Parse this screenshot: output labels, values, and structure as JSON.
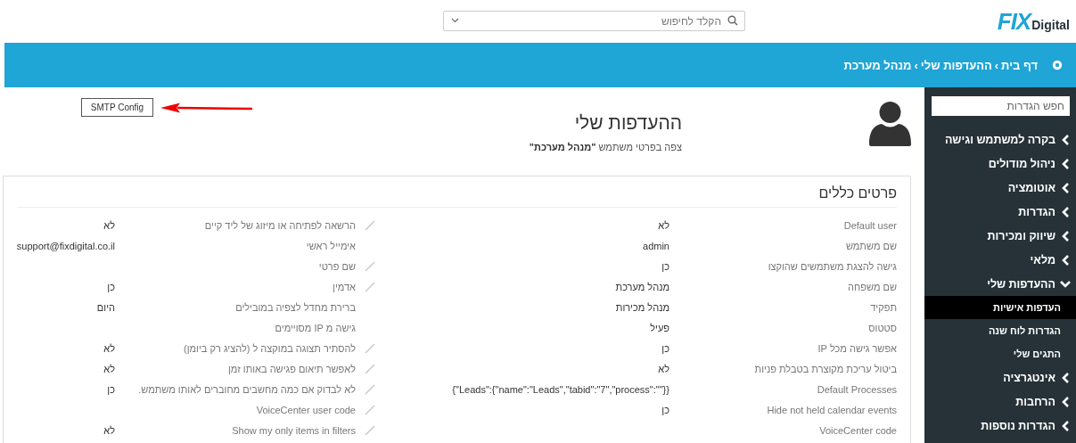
{
  "logo": {
    "mark": "FIX",
    "text": "Digital"
  },
  "search": {
    "placeholder": "הקלד לחיפוש"
  },
  "breadcrumb": {
    "separator": "›",
    "items": [
      "דף בית",
      "ההעדפות שלי",
      "מנהל מערכת"
    ]
  },
  "sidebar": {
    "search": {
      "placeholder": "חפש הגדרות"
    },
    "items": [
      {
        "label": "בקרה למשתמש וגישה",
        "expanded": false
      },
      {
        "label": "ניהול מודולים",
        "expanded": false
      },
      {
        "label": "אוטומציה",
        "expanded": false
      },
      {
        "label": "הגדרות",
        "expanded": false
      },
      {
        "label": "שיווק ומכירות",
        "expanded": false
      },
      {
        "label": "מלאי",
        "expanded": false
      },
      {
        "label": "ההעדפות שלי",
        "expanded": true,
        "children": [
          {
            "label": "העדפות אישיות",
            "selected": true
          },
          {
            "label": "הגדרות לוח שנה",
            "selected": false
          },
          {
            "label": "התגים שלי",
            "selected": false
          }
        ]
      },
      {
        "label": "אינטגרציה",
        "expanded": false
      },
      {
        "label": "הרחבות",
        "expanded": false
      },
      {
        "label": "הגדרות נוספות",
        "expanded": false
      }
    ]
  },
  "profile": {
    "title": "ההעדפות שלי",
    "subtitle": "צפה בפרטי משתמש  **\"מנהל מערכת\"**"
  },
  "smtp_button": "SMTP Config",
  "card": {
    "title": "פרטים כללים",
    "rows": [
      {
        "label": "Default user",
        "value": "לא",
        "label_2": "הרשאה לפתיחה או מיזוג של ליד קיים",
        "value_2": "לא",
        "editable_2": true
      },
      {
        "label": "שם משתמש",
        "value": "admin",
        "label_2": "אימייל ראשי",
        "value_2": "support@fixdigital.co.il",
        "editable_2": false
      },
      {
        "label": "גישה להצגת משתמשים שהוקצו",
        "value": "כן",
        "label_2": "שם פרטי",
        "editable_2": true
      },
      {
        "label": "שם משפחה",
        "value": "מנהל מערכת",
        "label_2": "אדמין",
        "value_2": "כן",
        "editable_2": true
      },
      {
        "label": "תפקיד",
        "value": "מנהל מכירות",
        "label_2": "ברירת מחדל לצפיה במובילים",
        "value_2": "היום",
        "editable_2": false
      },
      {
        "label": "סטטוס",
        "value": "פעיל",
        "label_2": "גישה מ IP מסויימים",
        "editable_2": false
      },
      {
        "label": "אפשר גישה מכל IP",
        "value": "כן",
        "label_2": "להסתיר תצוגה במוקצה ל (להציג רק ביומן)",
        "value_2": "לא",
        "editable_2": true
      },
      {
        "label": "ביטול עריכת מקוצרת בטבלת פניות",
        "value": "לא",
        "label_2": "לאפשר תיאום פגישה באותו זמן",
        "value_2": "לא",
        "editable_2": true
      },
      {
        "label": "Default Processes",
        "value": "{Leads\":{\"name\":\"Leads\",\"tabid\":\"7\",\"process\":\"\"}\"}",
        "label_2": "לא לבדוק אם כמה מחשבים מחוברים לאותו משתמש.",
        "value_2": "כן",
        "editable_2": true
      },
      {
        "label": "Hide not held calendar events",
        "value": "כן",
        "label_2": "VoiceCenter user code",
        "editable_2": true
      },
      {
        "label": "VoiceCenter code",
        "label_2": "Show my only items in filters",
        "value_2": "לא",
        "editable_2": true
      }
    ]
  }
}
